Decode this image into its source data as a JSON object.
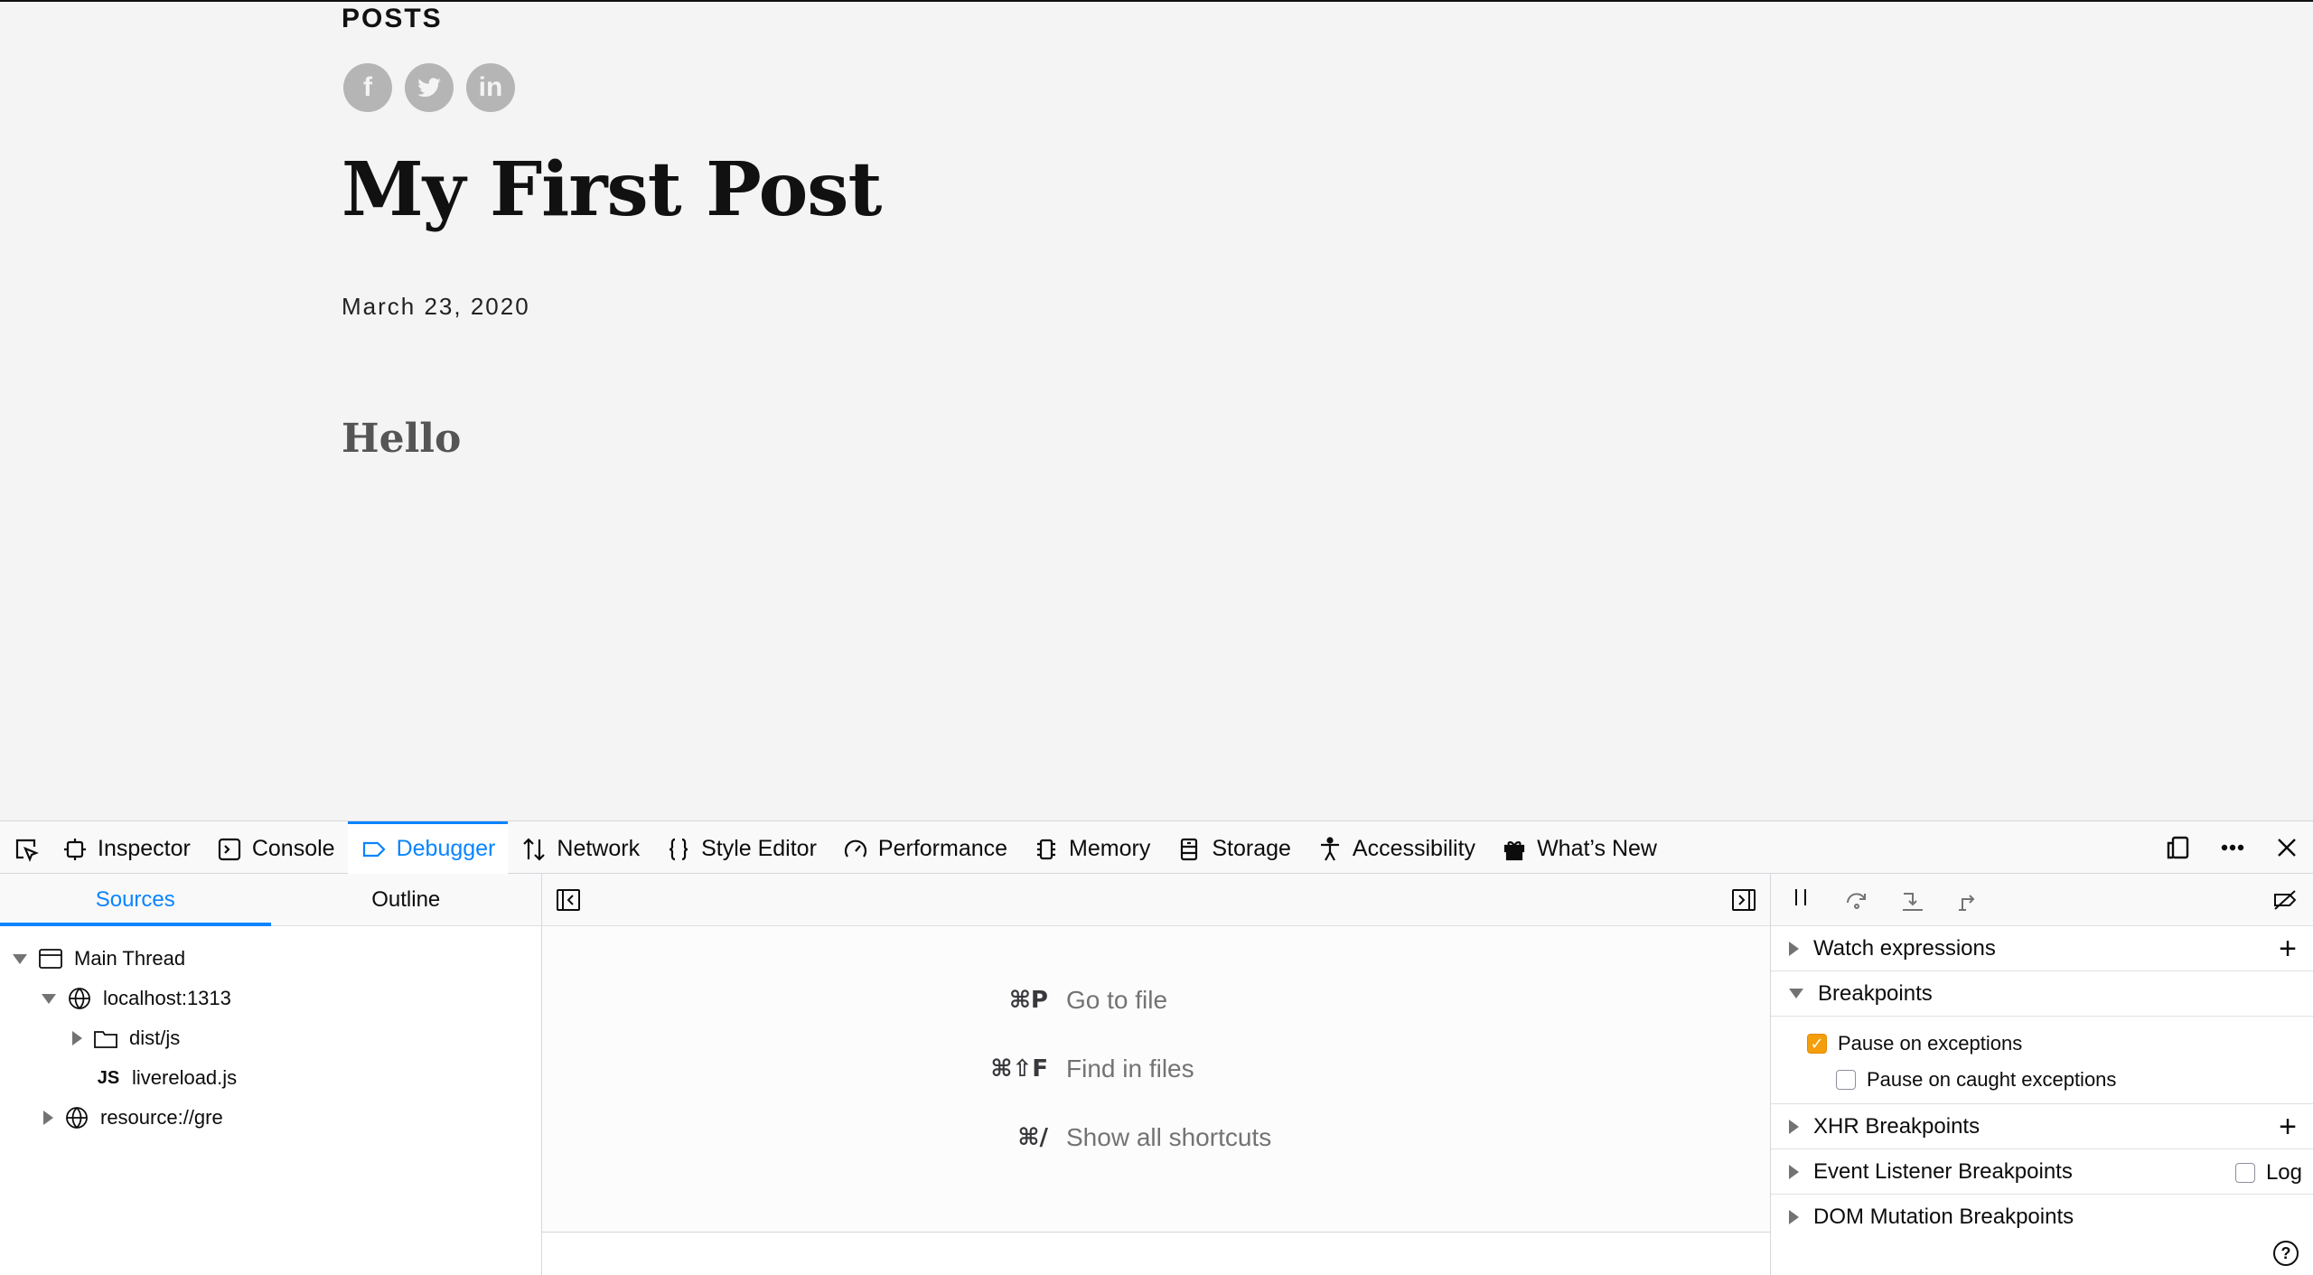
{
  "page": {
    "section_label": "POSTS",
    "social": [
      {
        "name": "facebook",
        "glyph": "f"
      },
      {
        "name": "twitter",
        "glyph": "t"
      },
      {
        "name": "linkedin",
        "glyph": "in"
      }
    ],
    "title": "My First Post",
    "date": "March 23, 2020",
    "body_heading": "Hello"
  },
  "devtools": {
    "tabs": [
      {
        "label": "Inspector"
      },
      {
        "label": "Console"
      },
      {
        "label": "Debugger",
        "selected": true
      },
      {
        "label": "Network"
      },
      {
        "label": "Style Editor"
      },
      {
        "label": "Performance"
      },
      {
        "label": "Memory"
      },
      {
        "label": "Storage"
      },
      {
        "label": "Accessibility"
      },
      {
        "label": "What’s New"
      }
    ],
    "left_tabs": {
      "sources": "Sources",
      "outline": "Outline"
    },
    "tree": {
      "main_thread": "Main Thread",
      "host": "localhost:1313",
      "folder": "dist/js",
      "file_badge": "JS",
      "file": "livereload.js",
      "resource": "resource://gre"
    },
    "shortcuts": [
      {
        "key": "⌘P",
        "label": "Go to file"
      },
      {
        "key": "⌘⇧F",
        "label": "Find in files"
      },
      {
        "key": "⌘/",
        "label": "Show all shortcuts"
      }
    ],
    "right": {
      "watch": "Watch expressions",
      "breakpoints": "Breakpoints",
      "pause_exceptions": "Pause on exceptions",
      "pause_caught": "Pause on caught exceptions",
      "xhr": "XHR Breakpoints",
      "event_listener": "Event Listener Breakpoints",
      "log": "Log",
      "dom_mutation": "DOM Mutation Breakpoints",
      "help": "?"
    },
    "accent_color": "#0a84ff",
    "checkbox_color": "#f49e0b"
  }
}
